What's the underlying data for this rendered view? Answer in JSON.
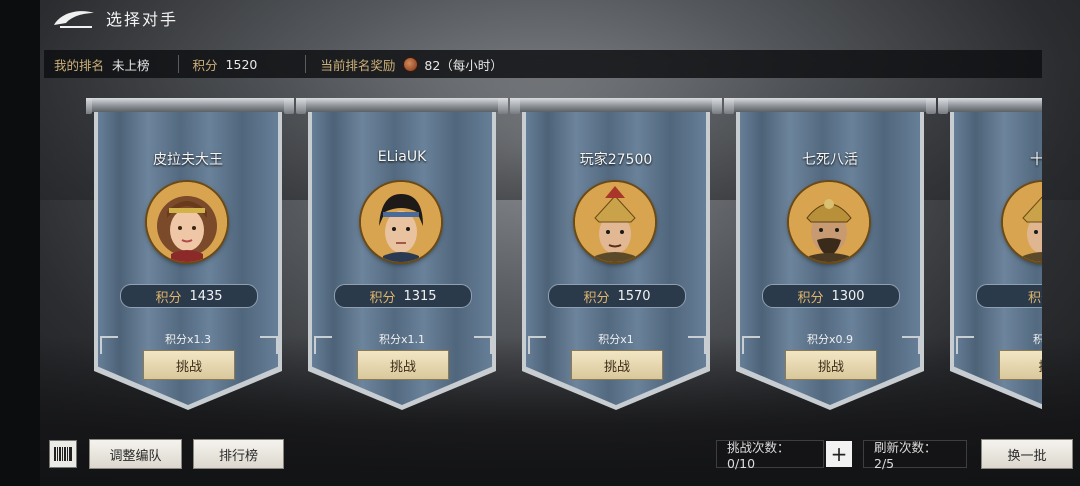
{
  "header": {
    "title": "选择对手"
  },
  "info": {
    "my_rank_label": "我的排名",
    "my_rank_value": "未上榜",
    "points_label": "积分",
    "points_value": "1520",
    "reward_label": "当前排名奖励",
    "reward_value": "82（每小时）"
  },
  "opponents": [
    {
      "name": "皮拉夫大王",
      "score_label": "积分",
      "score": "1435",
      "multiplier": "积分x1.3",
      "button": "挑战"
    },
    {
      "name": "ELiaUK",
      "score_label": "积分",
      "score": "1315",
      "multiplier": "积分x1.1",
      "button": "挑战"
    },
    {
      "name": "玩家27500",
      "score_label": "积分",
      "score": "1570",
      "multiplier": "积分x1",
      "button": "挑战"
    },
    {
      "name": "七死八活",
      "score_label": "积分",
      "score": "1300",
      "multiplier": "积分x0.9",
      "button": "挑战"
    },
    {
      "name": "十摸",
      "score_label": "积分",
      "score": "",
      "multiplier": "积分",
      "button": "挑"
    }
  ],
  "footer": {
    "formation_button": "调整编队",
    "leaderboard_button": "排行榜",
    "challenge_count": "挑战次数：0/10",
    "refresh_count": "刷新次数：2/5",
    "swap_button": "换一批"
  },
  "icons": [
    "back-arrow-icon",
    "barcode-icon",
    "coin-icon",
    "plus-icon"
  ]
}
